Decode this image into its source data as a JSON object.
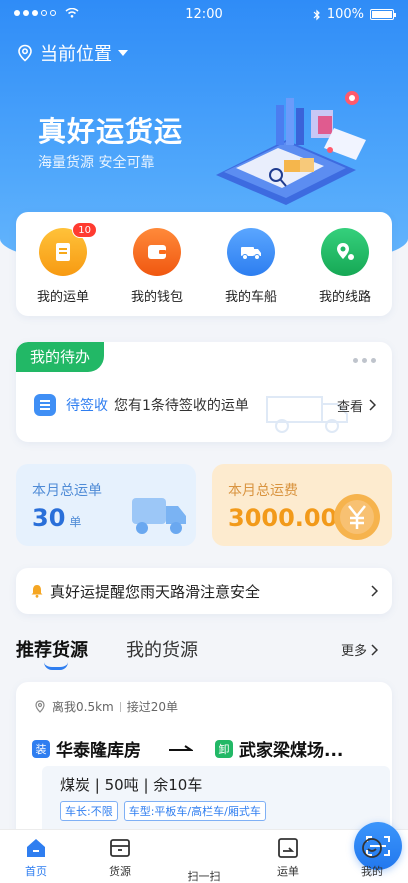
{
  "status": {
    "time": "12:00",
    "battery": "100%"
  },
  "header": {
    "location": "当前位置"
  },
  "hero": {
    "title": "真好运货运",
    "subtitle": "海量货源 安全可靠"
  },
  "quick": [
    {
      "label": "我的运单",
      "badge": "10",
      "color": "#f7a91a",
      "icon": "document-icon"
    },
    {
      "label": "我的钱包",
      "color": "#fb6b1b",
      "icon": "wallet-icon"
    },
    {
      "label": "我的车船",
      "color": "#3b8ef5",
      "icon": "truck-icon"
    },
    {
      "label": "我的线路",
      "color": "#22b866",
      "icon": "route-pin-icon"
    }
  ],
  "todo": {
    "title": "我的待办",
    "keyword": "待签收",
    "description": "您有1条待签收的运单",
    "action": "查看"
  },
  "stats": {
    "shipments_label": "本月总运单",
    "shipments_value": "30",
    "shipments_unit": "单",
    "freight_label": "本月总运费",
    "freight_value": "3000.00"
  },
  "notice": "真好运提醒您雨天路滑注意安全",
  "source_tabs": {
    "recommended": "推荐货源",
    "mine": "我的货源",
    "more": "更多"
  },
  "source_card": {
    "distance": "离我0.5km",
    "taken": "接过20单",
    "load_tag": "装",
    "unload_tag": "卸",
    "from": "华泰隆库房",
    "to": "武家梁煤场...",
    "goods": "煤炭 | 50吨 | 余10车",
    "pills": [
      "车长:不限",
      "车型:平板车/高栏车/厢式车"
    ]
  },
  "tabbar": [
    "首页",
    "货源",
    "扫一扫",
    "运单",
    "我的"
  ]
}
